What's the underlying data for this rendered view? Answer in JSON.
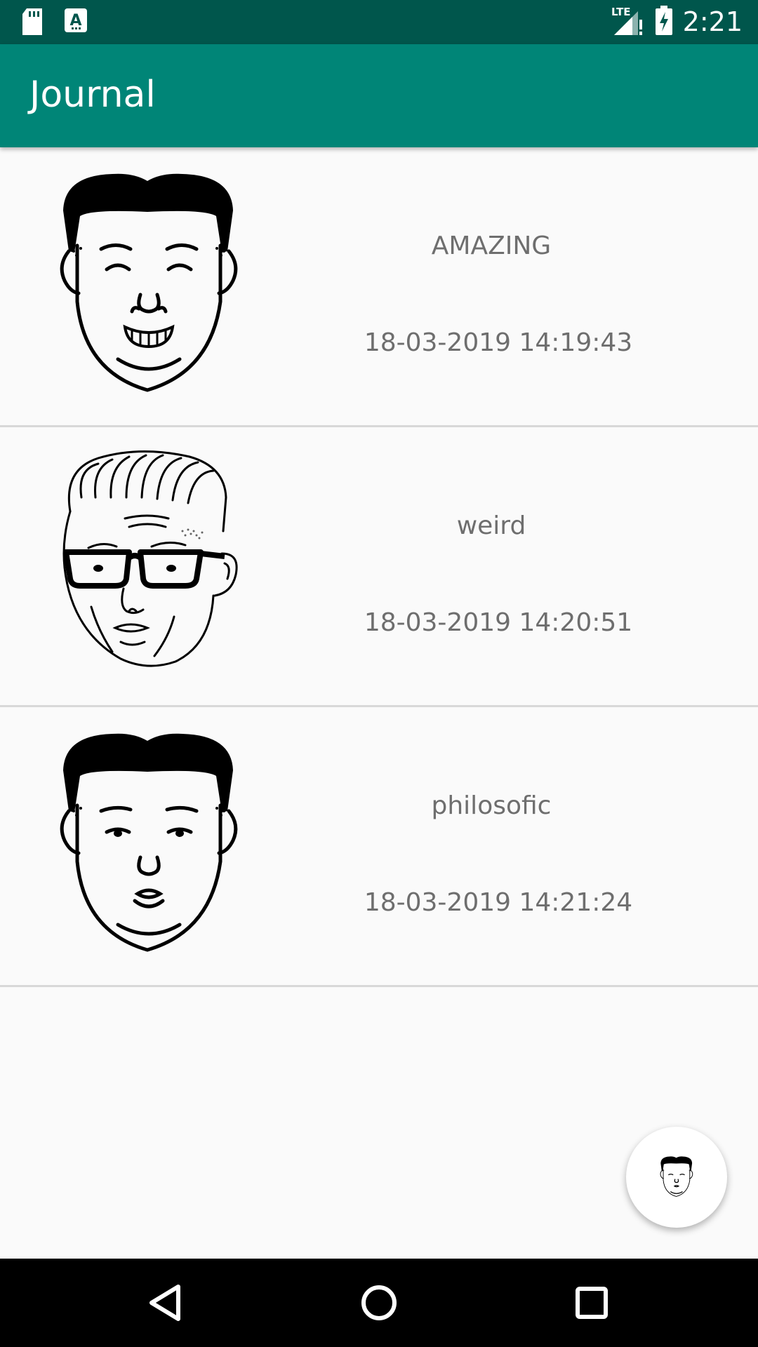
{
  "status_bar": {
    "time": "2:21",
    "network": "LTE",
    "icons": [
      "sd-card-icon",
      "text-input-icon",
      "lte-signal-icon",
      "battery-charging-icon"
    ]
  },
  "app_bar": {
    "title": "Journal",
    "color": "#008577"
  },
  "entries": [
    {
      "title": "AMAZING",
      "date": "18-03-2019 14:19:43",
      "face_icon": "laughing-face-icon"
    },
    {
      "title": "weird",
      "date": "18-03-2019 14:20:51",
      "face_icon": "glasses-face-icon"
    },
    {
      "title": "philosofic",
      "date": "18-03-2019 14:21:24",
      "face_icon": "neutral-face-icon"
    }
  ],
  "fab": {
    "icon": "face-icon"
  },
  "nav_bar": {
    "icons": [
      "back-icon",
      "home-icon",
      "recents-icon"
    ]
  },
  "colors": {
    "status_bar": "#00564c",
    "app_bar": "#008577",
    "text": "#6e6e6e",
    "background": "#fafafa"
  }
}
